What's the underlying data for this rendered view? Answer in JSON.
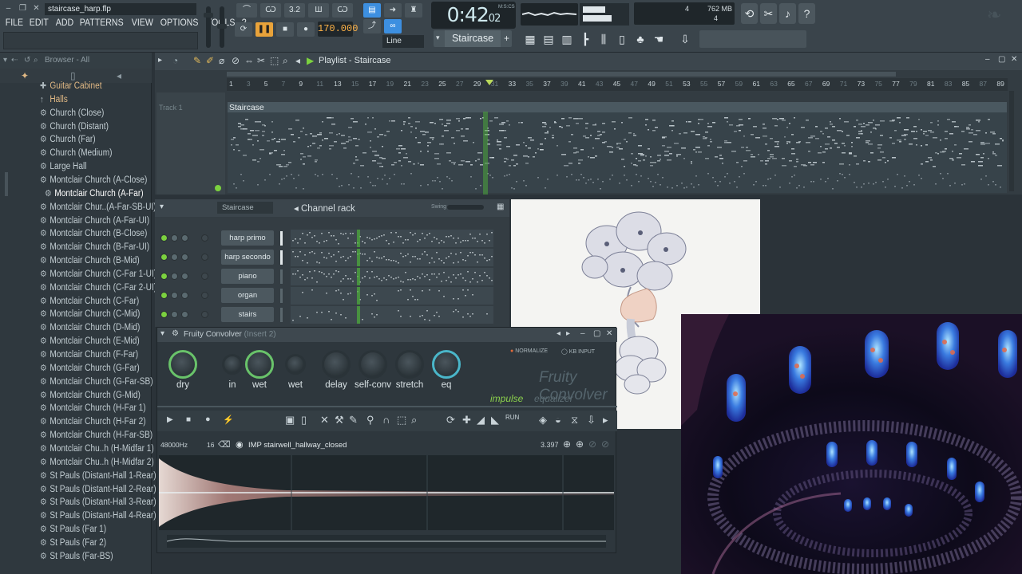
{
  "window": {
    "filename": "staircase_harp.flp",
    "min_label": "–",
    "restore_label": "❐",
    "close_label": "✕"
  },
  "menu": [
    "FILE",
    "EDIT",
    "ADD",
    "PATTERNS",
    "VIEW",
    "OPTIONS",
    "TOOLS",
    "?"
  ],
  "transport": {
    "bpm": "170.000",
    "time_main": "0:42",
    "time_sub": "02",
    "time_unit": "M:S:CS",
    "pattern_name": "Staircase",
    "snap": "Line"
  },
  "memory": {
    "cpu_value": "4",
    "mem_value": "762 MB",
    "poly_value": "4"
  },
  "browser": {
    "title": "Browser - All",
    "items": [
      {
        "label": "Guitar Cabinet",
        "type": "folder"
      },
      {
        "label": "Halls",
        "type": "folder"
      },
      {
        "label": "Church (Close)",
        "type": "preset"
      },
      {
        "label": "Church (Distant)",
        "type": "preset"
      },
      {
        "label": "Church (Far)",
        "type": "preset"
      },
      {
        "label": "Church (Medium)",
        "type": "preset"
      },
      {
        "label": "Large Hall",
        "type": "preset"
      },
      {
        "label": "Montclair Church (A-Close)",
        "type": "preset"
      },
      {
        "label": "Montclair Church (A-Far)",
        "type": "selected"
      },
      {
        "label": "Montclair Chur..(A-Far-SB-UI)",
        "type": "preset"
      },
      {
        "label": "Montclair Church (A-Far-UI)",
        "type": "preset"
      },
      {
        "label": "Montclair Church (B-Close)",
        "type": "preset"
      },
      {
        "label": "Montclair Church (B-Far-UI)",
        "type": "preset"
      },
      {
        "label": "Montclair Church (B-Mid)",
        "type": "preset"
      },
      {
        "label": "Montclair Church (C-Far 1-UI)",
        "type": "preset"
      },
      {
        "label": "Montclair Church (C-Far 2-UI)",
        "type": "preset"
      },
      {
        "label": "Montclair Church (C-Far)",
        "type": "preset"
      },
      {
        "label": "Montclair Church (C-Mid)",
        "type": "preset"
      },
      {
        "label": "Montclair Church (D-Mid)",
        "type": "preset"
      },
      {
        "label": "Montclair Church (E-Mid)",
        "type": "preset"
      },
      {
        "label": "Montclair Church (F-Far)",
        "type": "preset"
      },
      {
        "label": "Montclair Church (G-Far)",
        "type": "preset"
      },
      {
        "label": "Montclair Church (G-Far-SB)",
        "type": "preset"
      },
      {
        "label": "Montclair Church (G-Mid)",
        "type": "preset"
      },
      {
        "label": "Montclair Church (H-Far 1)",
        "type": "preset"
      },
      {
        "label": "Montclair Church (H-Far 2)",
        "type": "preset"
      },
      {
        "label": "Montclair Church (H-Far-SB)",
        "type": "preset"
      },
      {
        "label": "Montclair Chu..h (H-Midfar 1)",
        "type": "preset"
      },
      {
        "label": "Montclair Chu..h (H-Midfar 2)",
        "type": "preset"
      },
      {
        "label": "St Pauls (Distant-Hall 1-Rear)",
        "type": "preset"
      },
      {
        "label": "St Pauls (Distant-Hall 2-Rear)",
        "type": "preset"
      },
      {
        "label": "St Pauls (Distant-Hall 3-Rear)",
        "type": "preset"
      },
      {
        "label": "St Pauls (Distant-Hall 4-Rear)",
        "type": "preset"
      },
      {
        "label": "St Pauls (Far 1)",
        "type": "preset"
      },
      {
        "label": "St Pauls (Far 2)",
        "type": "preset"
      },
      {
        "label": "St Pauls (Far-BS)",
        "type": "preset"
      }
    ]
  },
  "playlist": {
    "title": "Playlist - Staircase",
    "track_name": "Track 1",
    "clip_name": "Staircase",
    "ruler": [
      "1",
      "3",
      "5",
      "7",
      "9",
      "11",
      "13",
      "15",
      "17",
      "19",
      "21",
      "23",
      "25",
      "27",
      "29",
      "31",
      "33",
      "35",
      "37",
      "39",
      "41",
      "43",
      "45",
      "47",
      "49",
      "51",
      "53",
      "55",
      "57",
      "59",
      "61",
      "63",
      "65",
      "67",
      "69",
      "71",
      "73",
      "75",
      "77",
      "79",
      "81",
      "83",
      "85",
      "87",
      "89"
    ]
  },
  "channel_rack": {
    "title": "Channel rack",
    "filter": "Staircase",
    "swing_label": "Swing",
    "channels": [
      {
        "name": "harp primo",
        "on": true
      },
      {
        "name": "harp secondo",
        "on": true
      },
      {
        "name": "piano",
        "on": true
      },
      {
        "name": "organ",
        "on": true
      },
      {
        "name": "stairs",
        "on": true
      }
    ]
  },
  "convolver": {
    "title": "Fruity Convolver",
    "insert": "(Insert 2)",
    "knobs": [
      "dry",
      "in",
      "wet",
      "wet",
      "delay",
      "self-conv",
      "stretch",
      "eq"
    ],
    "normalize": "NORMALIZE",
    "kb_input": "KB INPUT",
    "brand": "Fruity Convolver",
    "tab_impulse": "impulse",
    "tab_equalizer": "equalizer",
    "sample_rate": "48000Hz",
    "bits": "16",
    "impulse_name": "IMP stairwell_hallway_closed",
    "length": "3.397"
  },
  "colors": {
    "accent_green": "#7bd13f",
    "accent_blue": "#3d8fe0",
    "bpm_orange": "#ffb347"
  }
}
